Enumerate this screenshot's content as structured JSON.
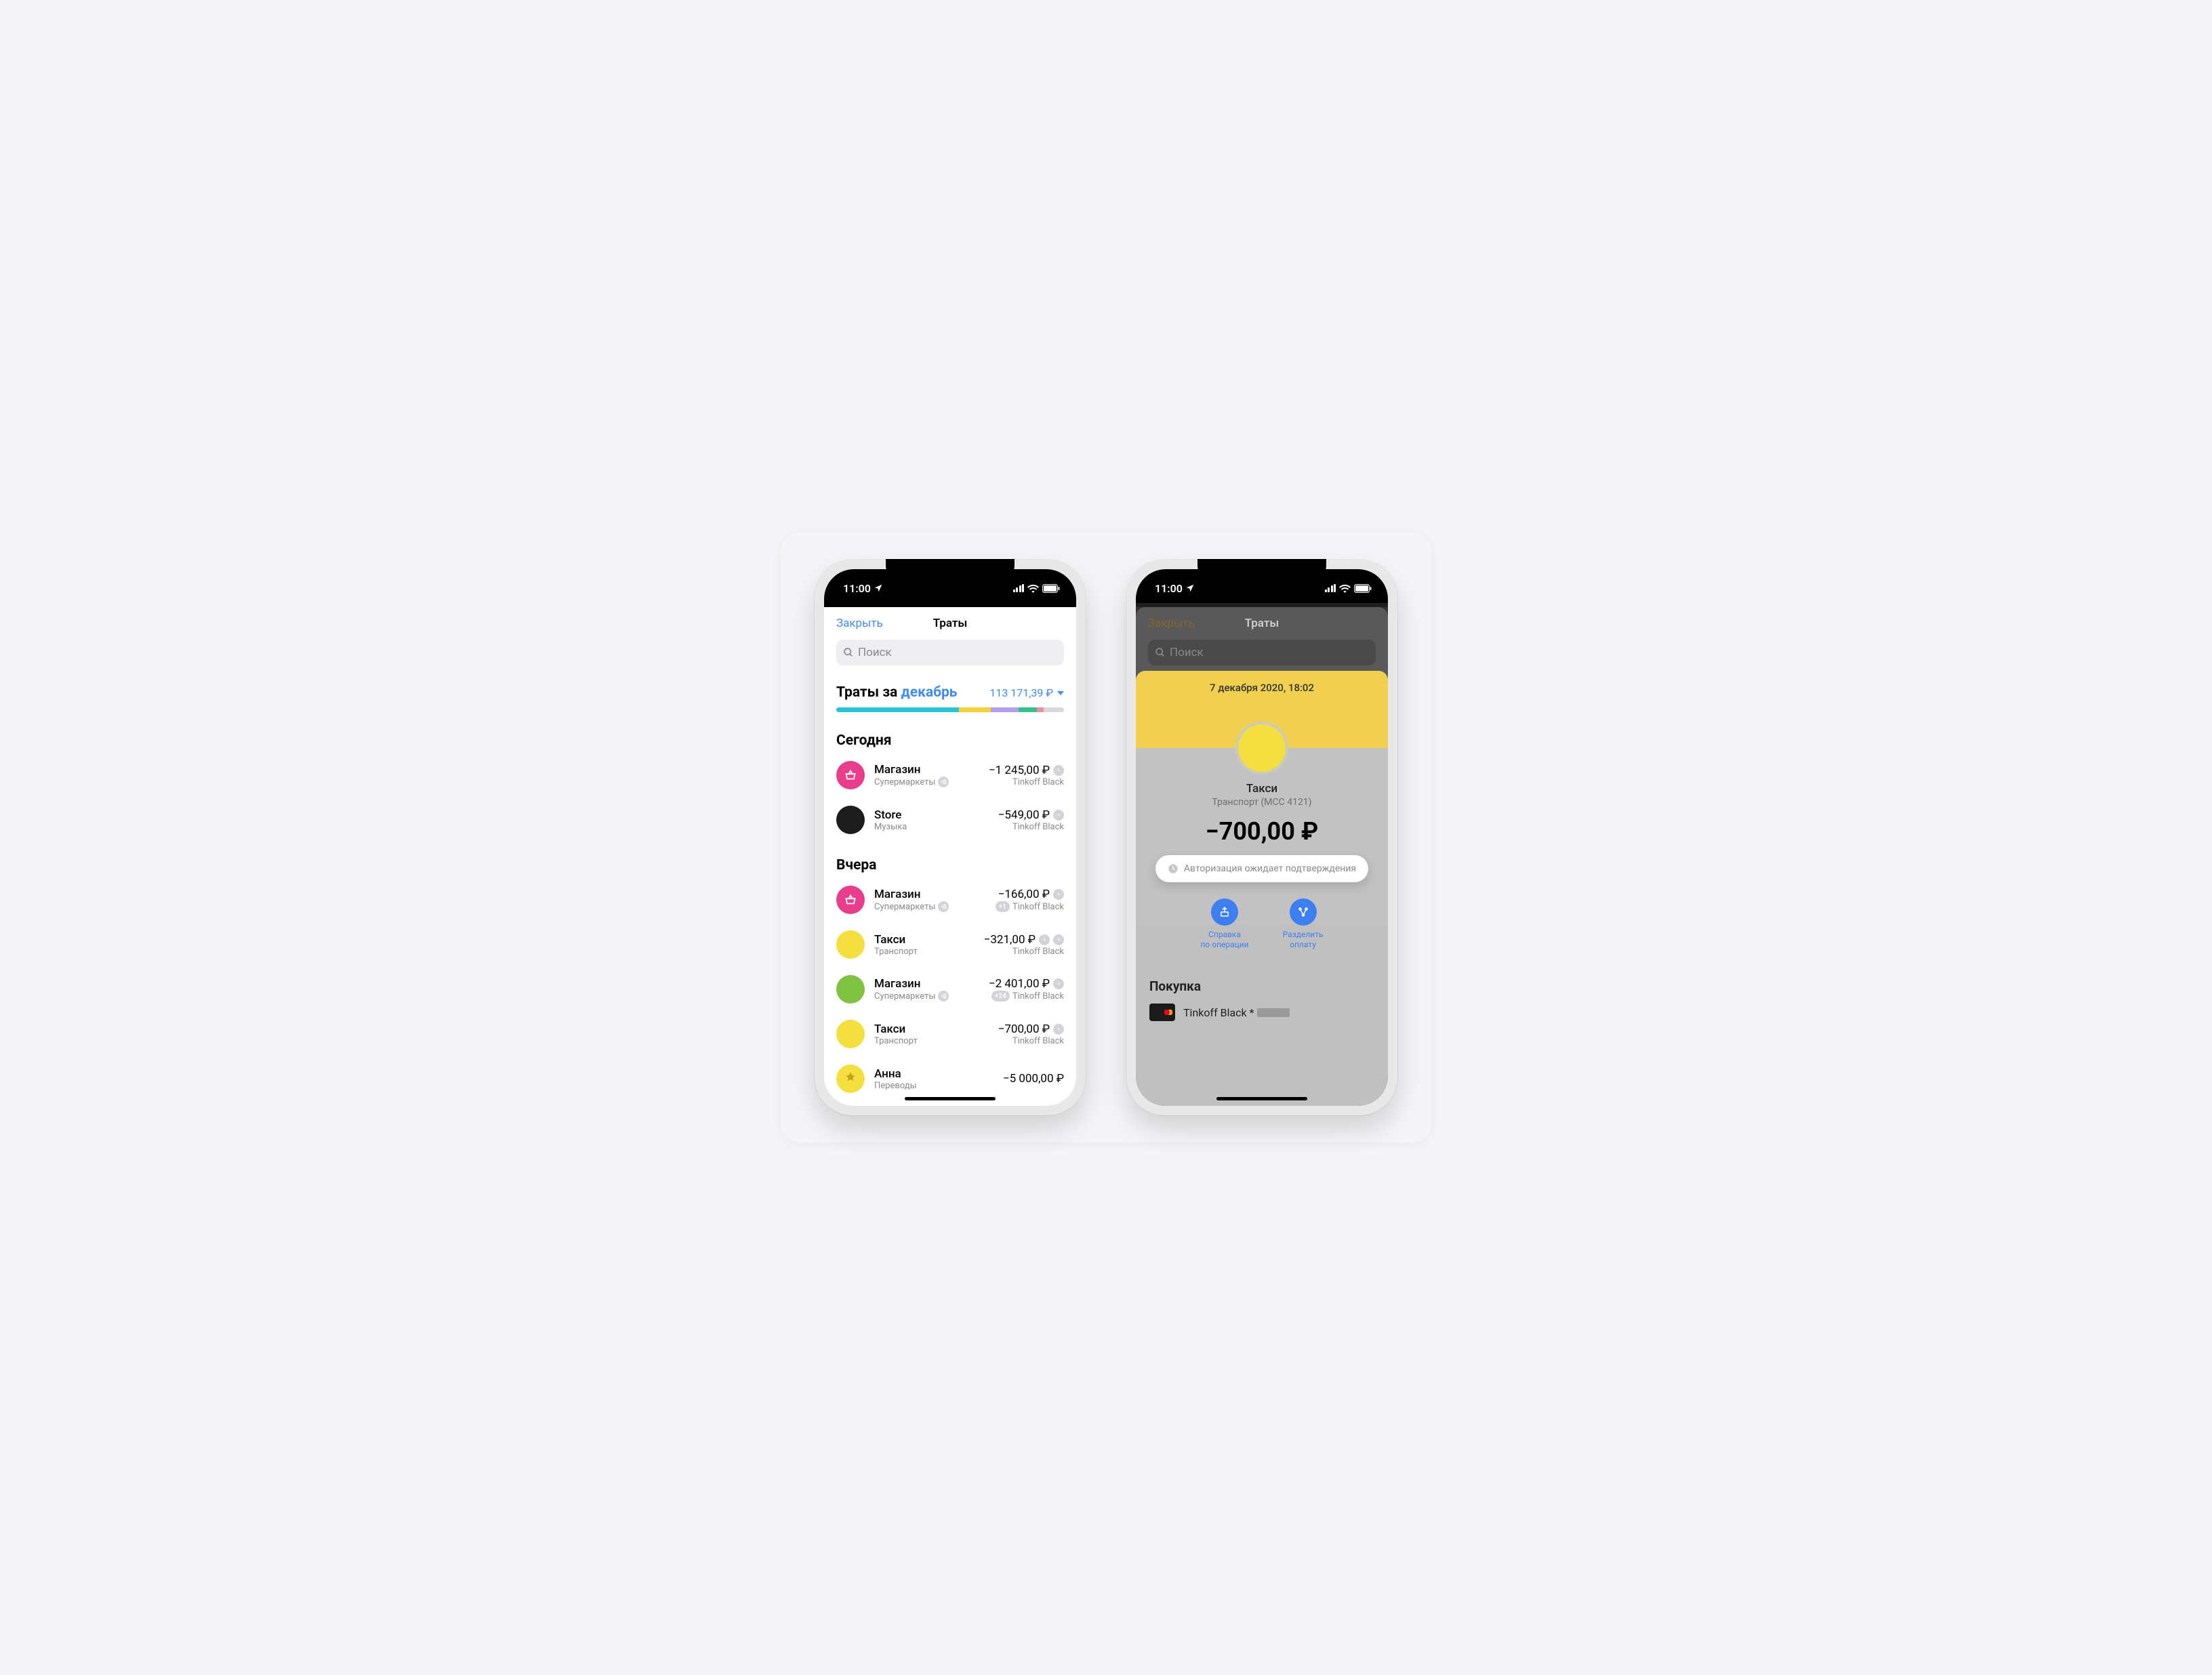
{
  "status": {
    "time": "11:00"
  },
  "phone1": {
    "nav": {
      "close": "Закрыть",
      "title": "Траты"
    },
    "search_placeholder": "Поиск",
    "summary": {
      "prefix": "Траты за ",
      "month": "декабрь",
      "total": "113 171,39 ₽"
    },
    "progress_segments": [
      {
        "color": "#28c3d7",
        "pct": 54
      },
      {
        "color": "#f6d23a",
        "pct": 14
      },
      {
        "color": "#b49df0",
        "pct": 12
      },
      {
        "color": "#36c08b",
        "pct": 8
      },
      {
        "color": "#f08fa0",
        "pct": 3
      },
      {
        "color": "#d9d9d9",
        "pct": 9
      }
    ],
    "sections": [
      {
        "title": "Сегодня",
        "items": [
          {
            "icon": "basket",
            "icon_color": "#e83e8c",
            "title": "Магазин",
            "subtitle": "Супермаркеты",
            "sub_badge": "wave",
            "amount": "−1 245,00 ₽",
            "card": "Tinkoff Black",
            "flags": [
              "clock"
            ]
          },
          {
            "icon": "solid",
            "icon_color": "#1c1c1c",
            "title": "Store",
            "subtitle": "Музыка",
            "amount": "−549,00 ₽",
            "card": "Tinkoff Black",
            "flags": [
              "clock"
            ]
          }
        ]
      },
      {
        "title": "Вчера",
        "items": [
          {
            "icon": "basket",
            "icon_color": "#e83e8c",
            "title": "Магазин",
            "subtitle": "Супермаркеты",
            "sub_badge": "wave",
            "amount": "−166,00 ₽",
            "card": "Tinkoff Black",
            "card_badge": "+1",
            "flags": [
              "clock"
            ]
          },
          {
            "icon": "solid",
            "icon_color": "#f4df40",
            "title": "Такси",
            "subtitle": "Транспорт",
            "amount": "−321,00 ₽",
            "card": "Tinkoff Black",
            "flags": [
              "clock",
              "clock"
            ]
          },
          {
            "icon": "solid",
            "icon_color": "#7fc241",
            "title": "Магазин",
            "subtitle": "Супермаркеты",
            "sub_badge": "wave",
            "amount": "−2 401,00 ₽",
            "card": "Tinkoff Black",
            "card_badge": "+24",
            "flags": [
              "clock"
            ]
          },
          {
            "icon": "solid",
            "icon_color": "#f4df40",
            "title": "Такси",
            "subtitle": "Транспорт",
            "amount": "−700,00 ₽",
            "card": "Tinkoff Black",
            "flags": [
              "clock"
            ]
          },
          {
            "icon": "emblem",
            "icon_color": "#f4df40",
            "title": "Анна",
            "subtitle": "Переводы",
            "amount": "−5 000,00 ₽",
            "card": "",
            "flags": []
          }
        ]
      }
    ]
  },
  "phone2": {
    "nav": {
      "close": "Закрыть",
      "title": "Траты"
    },
    "search_placeholder": "Поиск",
    "detail": {
      "date": "7 декабря 2020, 18:02",
      "name": "Такси",
      "category": "Транспорт (MCC 4121)",
      "amount": "−700,00 ₽",
      "auth_status": "Авторизация ожидает подтверждения",
      "actions": {
        "receipt": "Справка\nпо операции",
        "split": "Разделить\nоплату"
      },
      "purchase_title": "Покупка",
      "card": "Tinkoff Black *"
    }
  }
}
